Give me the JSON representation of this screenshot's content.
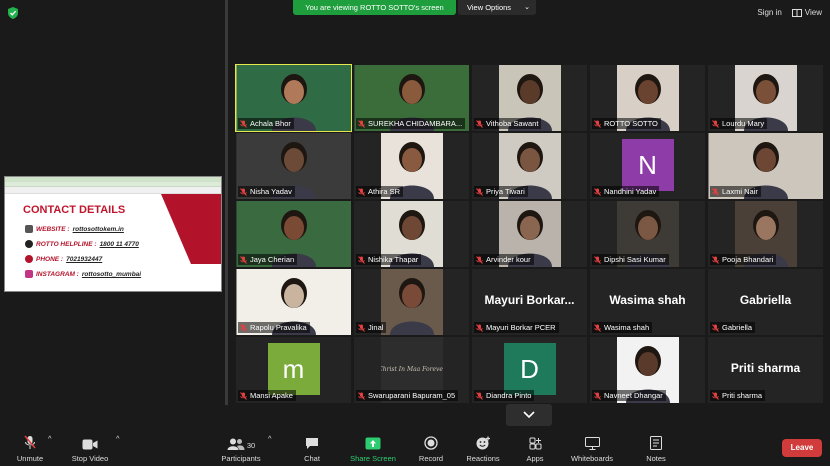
{
  "banner": {
    "sharing_text": "You are viewing ROTTO SOTTO's screen",
    "view_options": "View Options"
  },
  "top_right": {
    "sign_in": "Sign in",
    "view": "View"
  },
  "shared_screen": {
    "title": "CONTACT DETAILS",
    "rows": [
      {
        "label": "WEBSITE :",
        "value": "rottosottokem.in",
        "icon": "web-icon"
      },
      {
        "label": "ROTTO HELPLINE :",
        "value": "1800 11 4770",
        "icon": "helpline-icon"
      },
      {
        "label": "PHONE :",
        "value": "7021932447",
        "icon": "phone-icon"
      },
      {
        "label": "INSTAGRAM :",
        "value": "rottosotto_mumbai",
        "icon": "instagram-icon"
      }
    ]
  },
  "participants": [
    {
      "name": "Achala Bhor",
      "bg": "#2f6b45",
      "skin": "#b07a5a",
      "active": true
    },
    {
      "name": "SUREKHA CHIDAMBARA...",
      "bg": "#3a6d3a",
      "skin": "#8a5a3c"
    },
    {
      "name": "Vithoba Sawant",
      "bg": "#c9c5b8",
      "skin": "#5a3a28"
    },
    {
      "name": "ROTTO SOTTO",
      "bg": "#d8cfc7",
      "skin": "#6a4230"
    },
    {
      "name": "Lourdu Mary",
      "bg": "#d9d4cf",
      "skin": "#7a5038"
    },
    {
      "name": "Nisha Yadav",
      "bg": "#3b3b3b",
      "skin": "#6b4a38"
    },
    {
      "name": "Athira SR",
      "bg": "#e9e2db",
      "skin": "#8a5a40"
    },
    {
      "name": "Priya Tiwari",
      "bg": "#cfcac2",
      "skin": "#7a5540"
    },
    {
      "name": "Nandhini Yadav",
      "bg": "#8e3da8",
      "initial": "N"
    },
    {
      "name": "Laxmi Nair",
      "bg": "#ccc6bc",
      "skin": "#6e4634"
    },
    {
      "name": "Jaya Cherian",
      "bg": "#3a6a40",
      "skin": "#7a4a34"
    },
    {
      "name": "Nishika Thapar",
      "bg": "#e0ddd5",
      "skin": "#6e4834"
    },
    {
      "name": "Arvinder kour",
      "bg": "#b9b3ab",
      "skin": "#8a6650"
    },
    {
      "name": "Dipshi Sasi Kumar",
      "bg": "#3e3a36",
      "skin": "#7a5844"
    },
    {
      "name": "Pooja Bhandari",
      "bg": "#4a4038",
      "skin": "#9a7660"
    },
    {
      "name": "Rapolu Pravalika",
      "bg": "#f2efe9",
      "skin": "#c9b4a0"
    },
    {
      "name": "Jinal",
      "bg": "#6a5a4c",
      "skin": "#7a4a38"
    },
    {
      "name": "Mayuri Borkar PCER",
      "big": "Mayuri  Borkar..."
    },
    {
      "name": "Wasima shah",
      "big": "Wasima shah"
    },
    {
      "name": "Gabriella",
      "big": "Gabriella"
    },
    {
      "name": "Mansi Apake",
      "bg": "#7bab3a",
      "initial": "m"
    },
    {
      "name": "Swaruparani Bapuram_05",
      "bg": "#2d2d2d",
      "skin": "#c9c2b4",
      "art": "Christ In Maa Forever"
    },
    {
      "name": "Diandra Pinto",
      "bg": "#1e7a5a",
      "initial": "D"
    },
    {
      "name": "Navneet Dhangar",
      "bg": "#f2f2f2",
      "skin": "#5a3a2a"
    },
    {
      "name": "Priti sharma",
      "big": "Priti sharma"
    }
  ],
  "toolbar": {
    "unmute": "Unmute",
    "stop_video": "Stop Video",
    "participants": "Participants",
    "participant_count": "30",
    "chat": "Chat",
    "share_screen": "Share Screen",
    "record": "Record",
    "reactions": "Reactions",
    "apps": "Apps",
    "whiteboards": "Whiteboards",
    "notes": "Notes",
    "leave": "Leave"
  }
}
